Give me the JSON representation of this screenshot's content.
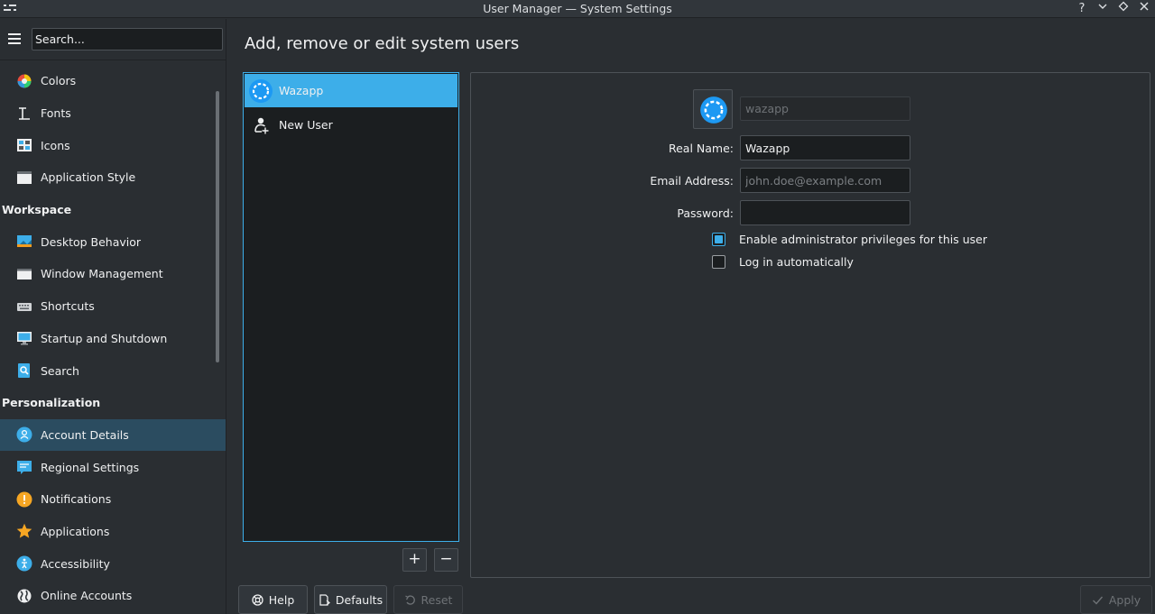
{
  "window": {
    "title": "User Manager — System Settings",
    "controls": {
      "help": "?",
      "minimize": "⌄",
      "maximize": "◇",
      "close": "✕"
    }
  },
  "sidebar": {
    "search_placeholder": "Search...",
    "items": [
      {
        "label": "Colors",
        "icon": "colors-icon"
      },
      {
        "label": "Fonts",
        "icon": "fonts-icon"
      },
      {
        "label": "Icons",
        "icon": "icons-icon"
      },
      {
        "label": "Application Style",
        "icon": "application-style-icon"
      }
    ],
    "workspace_header": "Workspace",
    "workspace_items": [
      {
        "label": "Desktop Behavior",
        "icon": "desktop-behavior-icon"
      },
      {
        "label": "Window Management",
        "icon": "window-management-icon"
      },
      {
        "label": "Shortcuts",
        "icon": "keyboard-icon"
      },
      {
        "label": "Startup and Shutdown",
        "icon": "monitor-icon"
      },
      {
        "label": "Search",
        "icon": "search-icon"
      }
    ],
    "personalization_header": "Personalization",
    "personalization_items": [
      {
        "label": "Account Details",
        "icon": "account-icon",
        "active": true
      },
      {
        "label": "Regional Settings",
        "icon": "regional-icon"
      },
      {
        "label": "Notifications",
        "icon": "notifications-icon"
      },
      {
        "label": "Applications",
        "icon": "star-icon"
      },
      {
        "label": "Accessibility",
        "icon": "accessibility-icon"
      },
      {
        "label": "Online Accounts",
        "icon": "globe-icon"
      }
    ]
  },
  "main": {
    "title": "Add, remove or edit system users",
    "users": [
      {
        "label": "Wazapp",
        "selected": true
      },
      {
        "label": "New User",
        "selected": false
      }
    ],
    "add_label": "+",
    "remove_label": "−"
  },
  "details": {
    "username_value": "wazapp",
    "real_name_label": "Real Name:",
    "real_name_value": "Wazapp",
    "email_label": "Email Address:",
    "email_placeholder": "john.doe@example.com",
    "password_label": "Password:",
    "password_value": "",
    "admin_label": "Enable administrator privileges for this user",
    "admin_checked": true,
    "autologin_label": "Log in automatically",
    "autologin_checked": false
  },
  "footer": {
    "help": "Help",
    "defaults": "Defaults",
    "reset": "Reset",
    "apply": "Apply"
  },
  "colors": {
    "accent": "#3daee9",
    "background": "#2a2e32",
    "active_sidebar": "#2b4c60"
  }
}
